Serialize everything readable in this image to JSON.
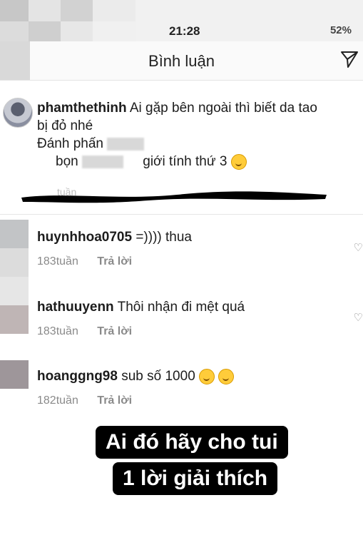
{
  "status": {
    "time": "21:28",
    "battery": "52%"
  },
  "header": {
    "title": "Bình luận"
  },
  "caption": {
    "username": "phamthethinh",
    "line1": "Ai gặp bên ngoài thì biết da tao",
    "line2": "bị đỏ nhé",
    "line3": "Đánh phấn",
    "line4_prefix": "bọn",
    "line4_suffix": "giới tính thứ 3",
    "time": "tuần"
  },
  "comments": [
    {
      "username": "huynhhoa0705",
      "text": "=)))) thua",
      "time": "183tuần",
      "reply": "Trả lời"
    },
    {
      "username": "hathuuyenn",
      "text": "Thôi nhận đi mệt quá",
      "time": "183tuần",
      "reply": "Trả lời"
    },
    {
      "username": "hoanggng98",
      "text": "sub số 1000",
      "time": "182tuần",
      "reply": "Trả lời"
    }
  ],
  "overlay": {
    "line1": "Ai đó hãy cho tui",
    "line2": "1 lời giải thích"
  },
  "colors": {
    "overlay_bg": "#000000",
    "meta_text": "#8a8a8a",
    "emoji": "#ffcc3a"
  }
}
